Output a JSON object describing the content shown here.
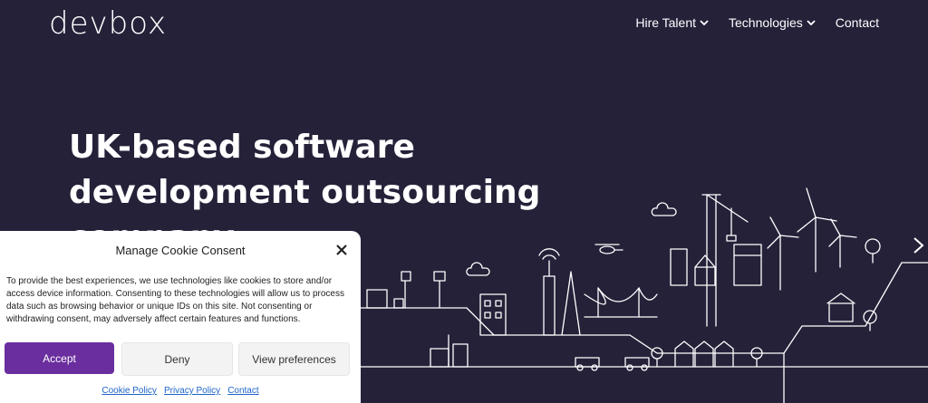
{
  "header": {
    "logo_text": "devbox",
    "nav": [
      {
        "label": "Hire Talent",
        "dropdown": true
      },
      {
        "label": "Technologies",
        "dropdown": true
      },
      {
        "label": "Contact",
        "dropdown": false
      }
    ]
  },
  "hero": {
    "title_lines": [
      "UK-based software",
      "development outsourcing",
      "company"
    ]
  },
  "cookie_banner": {
    "title": "Manage Cookie Consent",
    "message": "To provide the best experiences, we use technologies like cookies to store and/or access device information. Consenting to these technologies will allow us to process data such as browsing behavior or unique IDs on this site. Not consenting or withdrawing consent, may adversely affect certain features and functions.",
    "accept_label": "Accept",
    "deny_label": "Deny",
    "preferences_label": "View preferences",
    "links": [
      "Cookie Policy",
      "Privacy Policy",
      "Contact"
    ]
  },
  "colors": {
    "background": "#252139",
    "accent": "#6a2e9e",
    "link": "#1e64c8"
  }
}
